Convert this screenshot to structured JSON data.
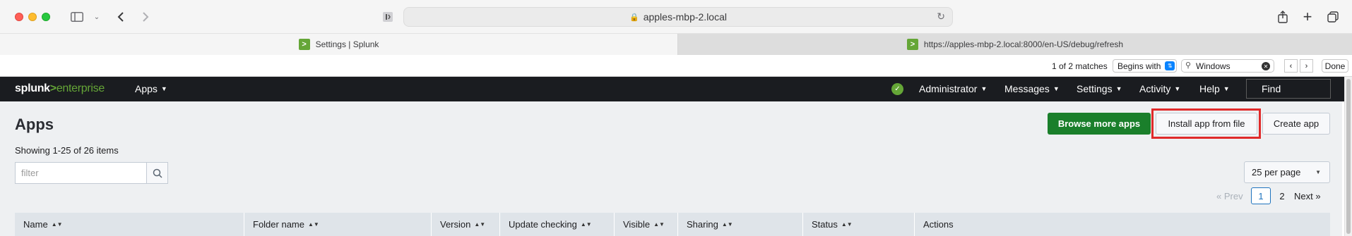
{
  "browser": {
    "address": "apples-mbp-2.local",
    "tabs": [
      {
        "favicon": ">",
        "title": "Settings | Splunk"
      },
      {
        "favicon": ">",
        "title": "https://apples-mbp-2.local:8000/en-US/debug/refresh"
      }
    ],
    "find": {
      "count": "1 of 2 matches",
      "mode": "Begins with",
      "query": "Windows",
      "done_label": "Done"
    }
  },
  "splunk_nav": {
    "logo_prefix": "splunk",
    "logo_gt": ">",
    "logo_suffix": "enterprise",
    "apps": "Apps",
    "administrator": "Administrator",
    "messages": "Messages",
    "settings": "Settings",
    "activity": "Activity",
    "help": "Help",
    "find": "Find"
  },
  "page": {
    "title": "Apps",
    "showing": "Showing 1-25 of 26 items",
    "filter_placeholder": "filter",
    "browse_label": "Browse more apps",
    "install_label": "Install app from file",
    "create_label": "Create app",
    "per_page": "25 per page",
    "pager": {
      "prev": "« Prev",
      "pages": [
        "1",
        "2"
      ],
      "next": "Next »",
      "current": "1"
    }
  },
  "table": {
    "columns": [
      "Name",
      "Folder name",
      "Version",
      "Update checking",
      "Visible",
      "Sharing",
      "Status",
      "Actions"
    ]
  },
  "colors": {
    "splunk_green": "#65a637",
    "browse_button": "#1a7f2b",
    "highlight": "#e02a2a",
    "nav_bg": "#1a1c20"
  }
}
